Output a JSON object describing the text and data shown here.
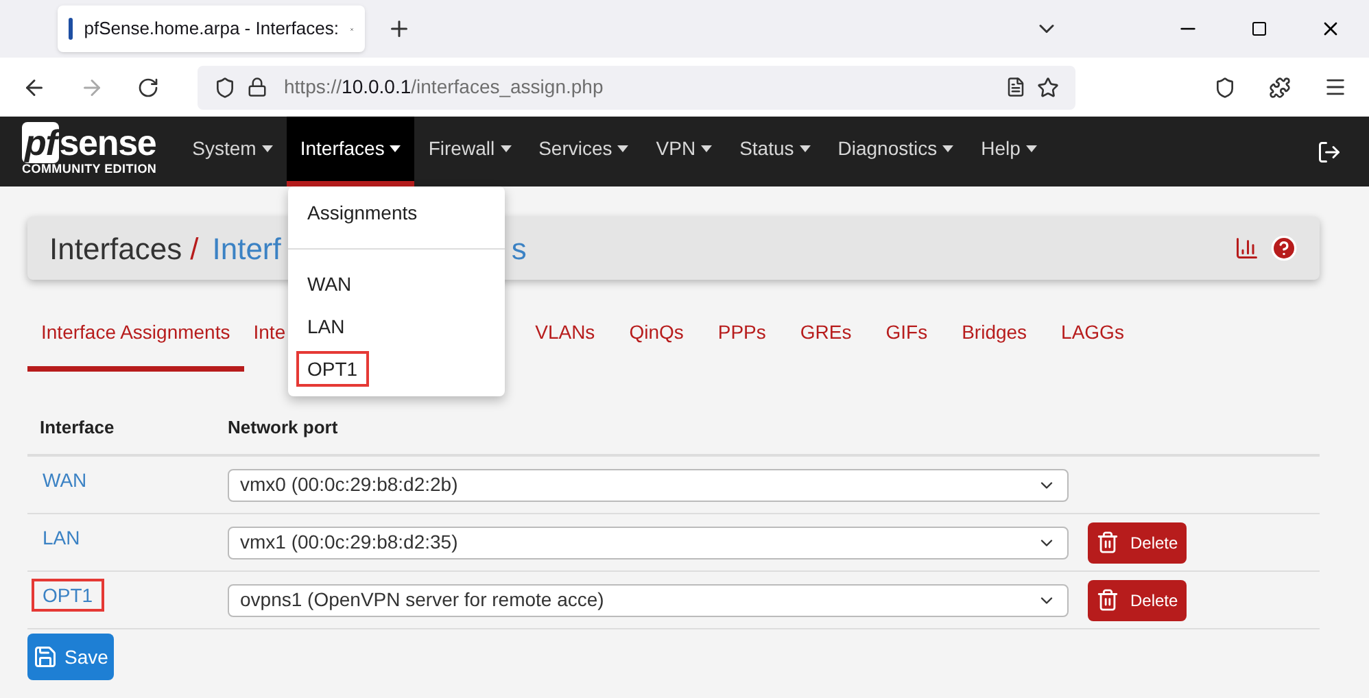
{
  "browser": {
    "tab_title": "pfSense.home.arpa - Interfaces:",
    "url_prefix": "https://",
    "url_host": "10.0.0.1",
    "url_path": "/interfaces_assign.php"
  },
  "logo": {
    "brand": "sense",
    "brand_prefix": "pf",
    "edition": "COMMUNITY EDITION"
  },
  "nav": [
    {
      "label": "System",
      "selected": false
    },
    {
      "label": "Interfaces",
      "selected": true
    },
    {
      "label": "Firewall",
      "selected": false
    },
    {
      "label": "Services",
      "selected": false
    },
    {
      "label": "VPN",
      "selected": false
    },
    {
      "label": "Status",
      "selected": false
    },
    {
      "label": "Diagnostics",
      "selected": false
    },
    {
      "label": "Help",
      "selected": false
    }
  ],
  "dropdown": [
    {
      "kind": "item",
      "label": "Assignments",
      "highlighted": false
    },
    {
      "kind": "divider"
    },
    {
      "kind": "item",
      "label": "WAN",
      "highlighted": false
    },
    {
      "kind": "item",
      "label": "LAN",
      "highlighted": false
    },
    {
      "kind": "item",
      "label": "OPT1",
      "highlighted": true
    }
  ],
  "breadcrumb": {
    "section": "Interfaces",
    "separator": "/",
    "page_start": "Interf",
    "page_end": "s"
  },
  "tabs": [
    {
      "label": "Interface Assignments",
      "selected": true,
      "covered_after": false
    },
    {
      "label": "Inte",
      "selected": false,
      "covered_after": true
    },
    {
      "label": "VLANs",
      "selected": false,
      "covered_after": false
    },
    {
      "label": "QinQs",
      "selected": false,
      "covered_after": false
    },
    {
      "label": "PPPs",
      "selected": false,
      "covered_after": false
    },
    {
      "label": "GREs",
      "selected": false,
      "covered_after": false
    },
    {
      "label": "GIFs",
      "selected": false,
      "covered_after": false
    },
    {
      "label": "Bridges",
      "selected": false,
      "covered_after": false
    },
    {
      "label": "LAGGs",
      "selected": false,
      "covered_after": false
    }
  ],
  "table": {
    "columns": [
      "Interface",
      "Network port"
    ],
    "rows": [
      {
        "interface": "WAN",
        "port": "vmx0 (00:0c:29:b8:d2:2b)",
        "highlighted": false,
        "delete": null
      },
      {
        "interface": "LAN",
        "port": "vmx1 (00:0c:29:b8:d2:35)",
        "highlighted": false,
        "delete": "Delete"
      },
      {
        "interface": "OPT1",
        "port": "ovpns1 (OpenVPN server for remote acce)",
        "highlighted": true,
        "delete": "Delete"
      }
    ]
  },
  "save_button": "Save"
}
